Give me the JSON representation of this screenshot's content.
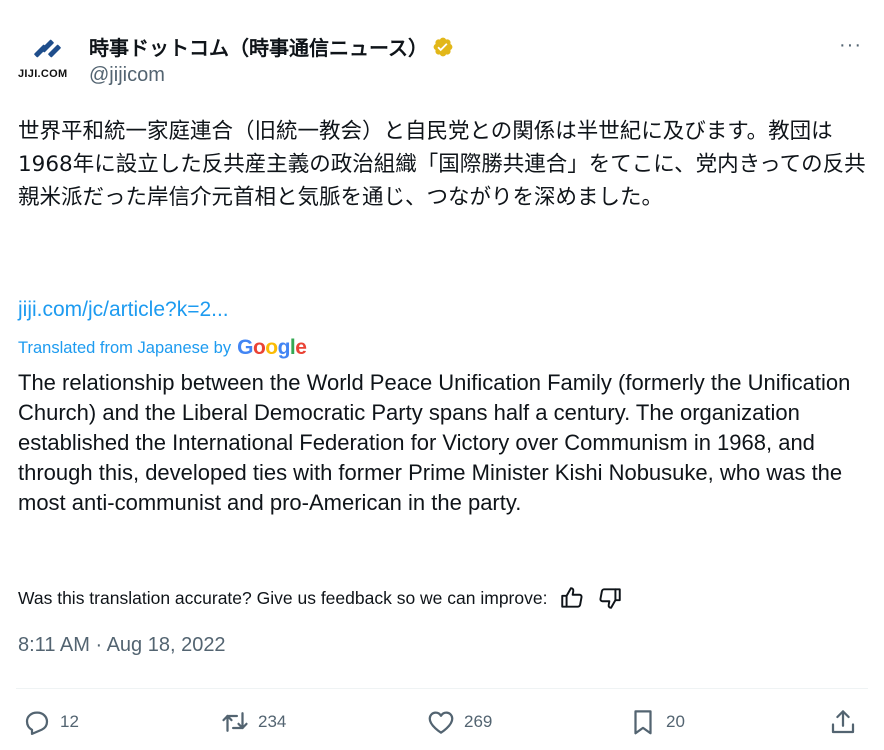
{
  "author": {
    "display_name": "時事ドットコム（時事通信ニュース）",
    "handle": "@jijicom",
    "avatar_text": "JIJI.COM",
    "verified_color": "#e2b719"
  },
  "more_icon": "···",
  "tweet": {
    "text_jp": "世界平和統一家庭連合（旧統一教会）と自民党との関係は半世紀に及びます。教団は1968年に設立した反共産主義の政治組織「国際勝共連合」をてこに、党内きっての反共親米派だった岸信介元首相と気脈を通じ、つながりを深めました。",
    "link": "jiji.com/jc/article?k=2...",
    "translated_label": "Translated from Japanese by",
    "google": {
      "G": "G",
      "o1": "o",
      "o2": "o",
      "g": "g",
      "l": "l",
      "e": "e"
    },
    "text_en": "The relationship between the World Peace Unification Family (formerly the Unification Church) and the Liberal Democratic Party spans half a century. The organization established the International Federation for Victory over Communism in 1968, and through this, developed ties with former Prime Minister Kishi Nobusuke, who was the most anti-communist and pro-American in the party.",
    "feedback_prompt": "Was this translation accurate? Give us feedback so we can improve:",
    "timestamp": "8:11 AM · Aug 18, 2022"
  },
  "metrics": {
    "replies": "12",
    "retweets": "234",
    "likes": "269",
    "bookmarks": "20"
  },
  "colors": {
    "link": "#1d9bf0",
    "muted": "#536471",
    "text": "#0f1419"
  }
}
